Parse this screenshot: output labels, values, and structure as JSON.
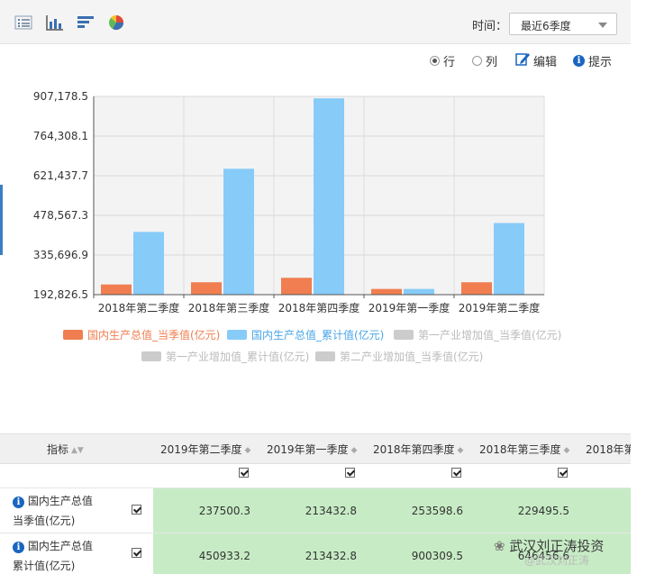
{
  "toolbar": {
    "icons": [
      "list-view-icon",
      "bar-chart-icon",
      "horizontal-bar-icon",
      "pie-chart-icon"
    ],
    "time_label": "时间：",
    "time_select": "最近6季度"
  },
  "options": {
    "row_label": "行",
    "col_label": "列",
    "edit_label": "编辑",
    "hint_label": "提示",
    "selected": "row"
  },
  "chart_data": {
    "type": "bar",
    "categories": [
      "2018年第二季度",
      "2018年第三季度",
      "2018年第四季度",
      "2019年第一季度",
      "2019年第二季度"
    ],
    "series": [
      {
        "name": "国内生产总值_当季值(亿元)",
        "color": "#f07e50",
        "values": [
          229495.5,
          237500.3,
          253598.6,
          213432.8,
          237500.3
        ]
      },
      {
        "name": "国内生产总值_累计值(亿元)",
        "color": "#87cbf9",
        "values": [
          418961.1,
          646456.6,
          900309.5,
          213432.8,
          450933.2
        ]
      }
    ],
    "yticks": [
      "907,178.5",
      "764,308.1",
      "621,437.7",
      "478,567.3",
      "335,696.9",
      "192,826.5"
    ],
    "ylim": [
      192826.5,
      907178.5
    ],
    "legend": [
      {
        "label": "国内生产总值_当季值(亿元)",
        "color": "#f07e50",
        "active": true
      },
      {
        "label": "国内生产总值_累计值(亿元)",
        "color": "#87cbf9",
        "active": true
      },
      {
        "label": "第一产业增加值_当季值(亿元)",
        "color": "#cccccc",
        "active": false
      },
      {
        "label": "第一产业增加值_累计值(亿元)",
        "color": "#cccccc",
        "active": false
      },
      {
        "label": "第二产业增加值_当季值(亿元)",
        "color": "#cccccc",
        "active": false
      }
    ],
    "grid": true
  },
  "table": {
    "indicator_header": "指标",
    "columns": [
      "2019年第二季度",
      "2019年第一季度",
      "2018年第四季度",
      "2018年第三季度",
      "2018年第"
    ],
    "rows": [
      {
        "name_line1": "国内生产总值",
        "name_line2": "当季值(亿元)",
        "values": [
          "237500.3",
          "213432.8",
          "253598.6",
          "229495.5"
        ]
      },
      {
        "name_line1": "国内生产总值",
        "name_line2": "累计值(亿元)",
        "values": [
          "450933.2",
          "213432.8",
          "900309.5",
          "646456.6"
        ]
      }
    ]
  },
  "watermark": {
    "line1": "武汉刘正涛投资",
    "line2": "@武汉刘正涛"
  }
}
